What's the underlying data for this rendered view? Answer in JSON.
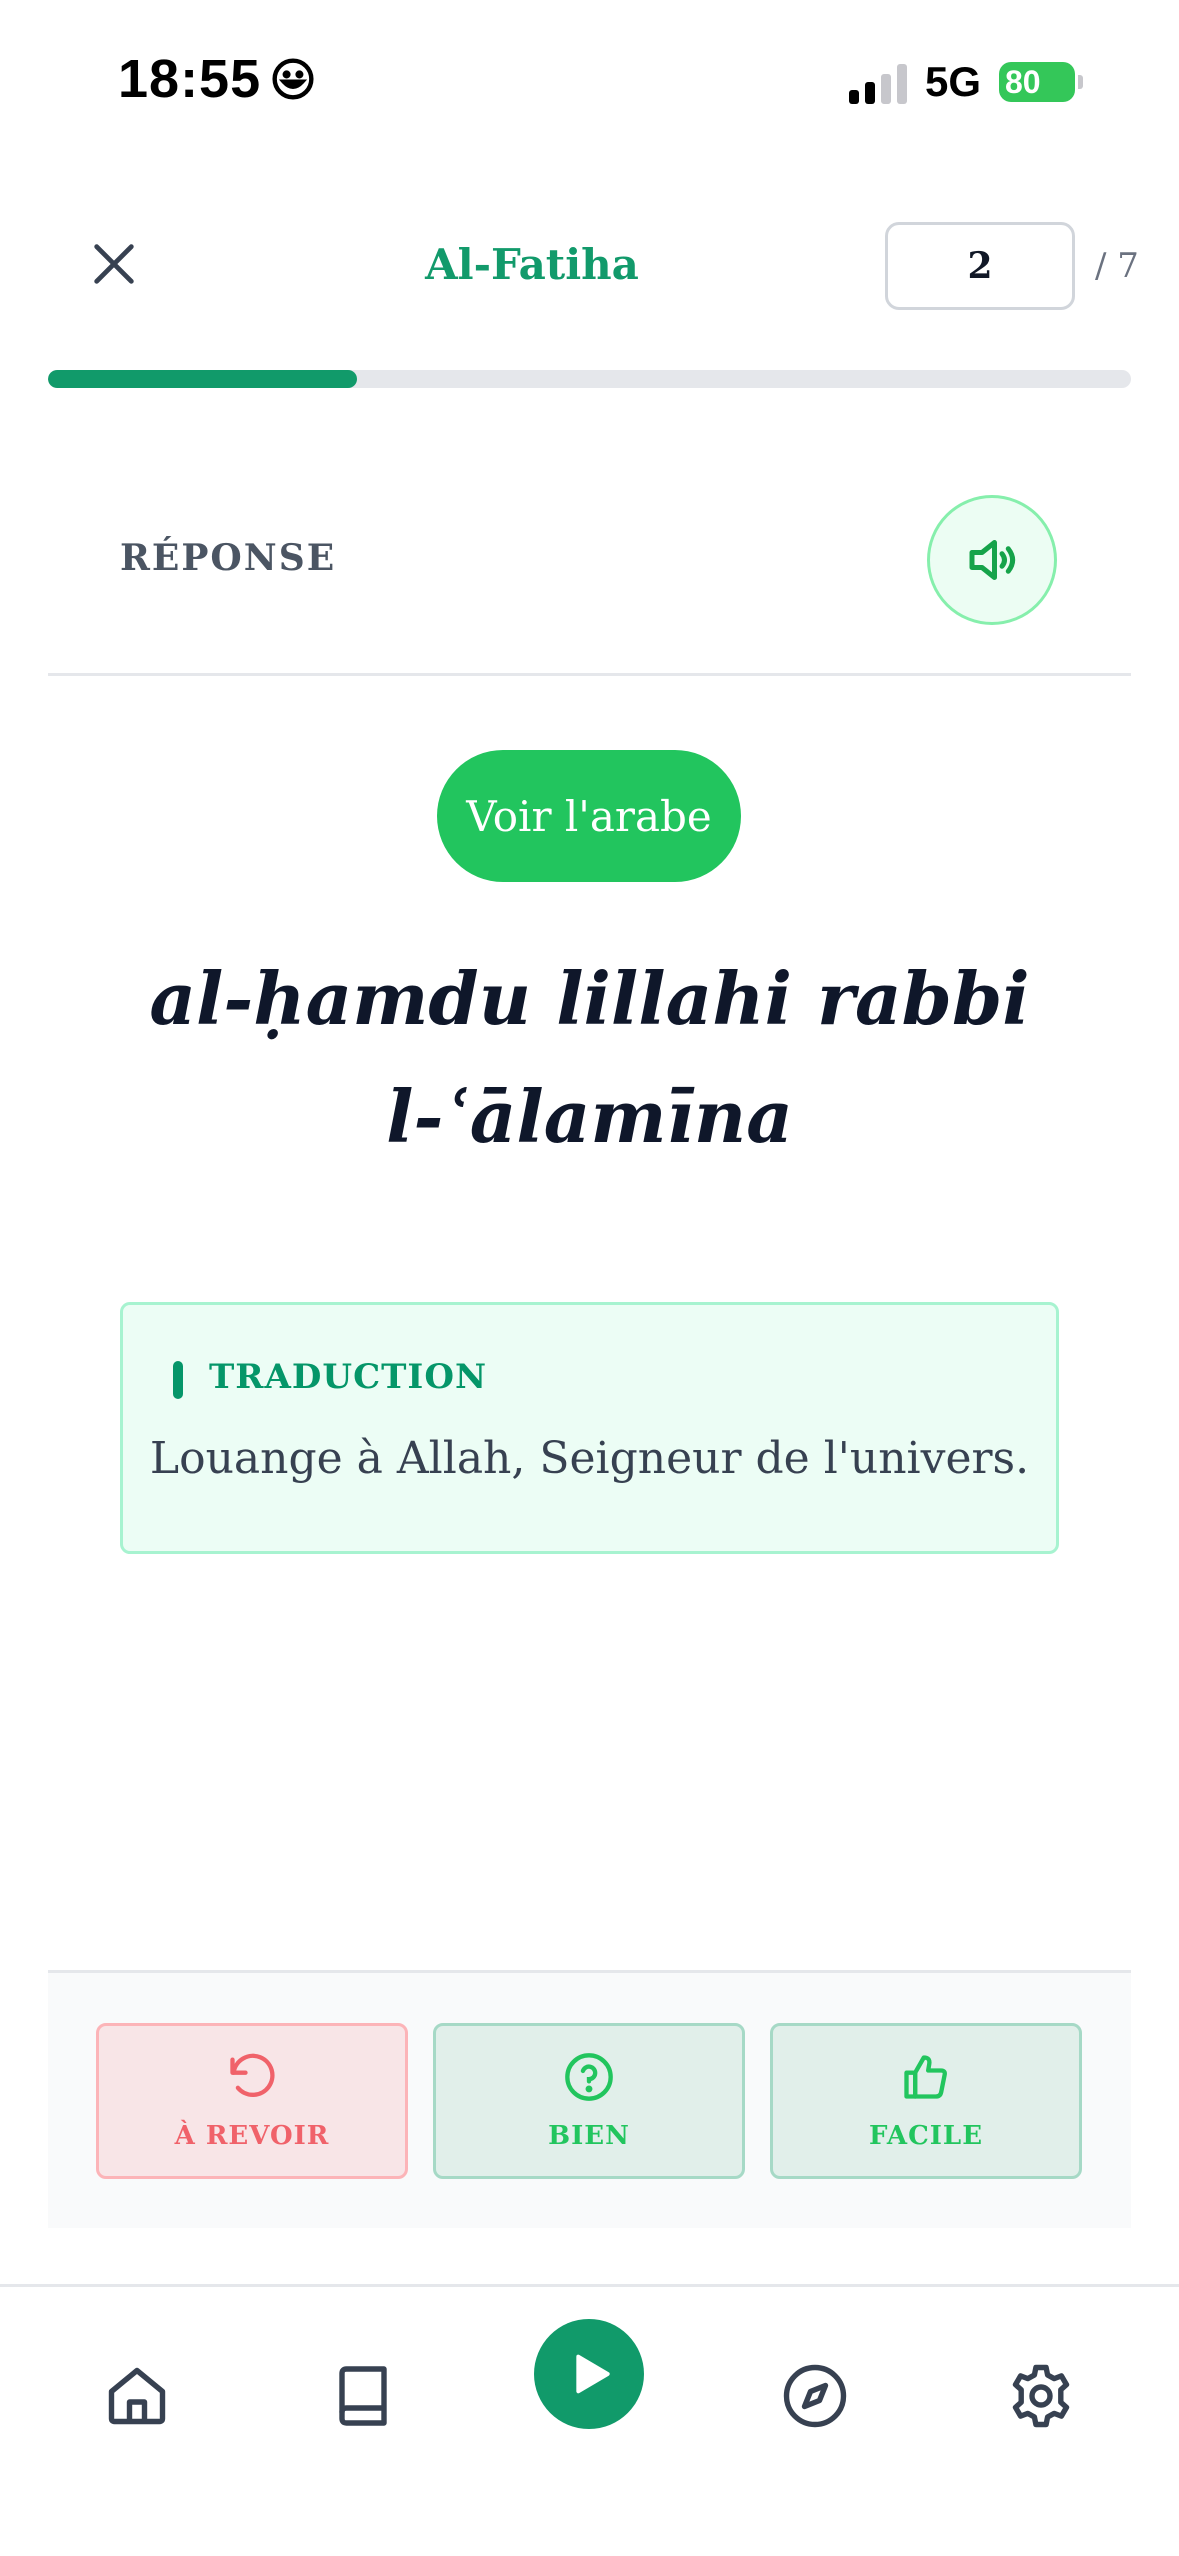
{
  "status_bar": {
    "time": "18:55",
    "network": "5G",
    "battery": "80"
  },
  "header": {
    "title": "Al-Fatiha",
    "current_verse": "2",
    "total": "/ 7"
  },
  "progress": {
    "fraction": 0.285
  },
  "answer": {
    "section_label": "RÉPONSE",
    "show_arabic_label": "Voir l'arabe"
  },
  "verse": {
    "transliteration": "al-ḥamdu lillahi rabbi l-ʿālamīna"
  },
  "translation": {
    "label": "TRADUCTION",
    "text": "Louange à Allah, Seigneur de l'univers."
  },
  "rating": {
    "again_label": "À REVOIR",
    "good_label": "BIEN",
    "easy_label": "FACILE"
  },
  "nav": {
    "items": [
      "home-icon",
      "book-icon",
      "play-icon",
      "compass-icon",
      "settings-icon"
    ]
  },
  "colors": {
    "primary": "#119a6a",
    "accent": "#22c55e",
    "danger": "#f0626a"
  }
}
